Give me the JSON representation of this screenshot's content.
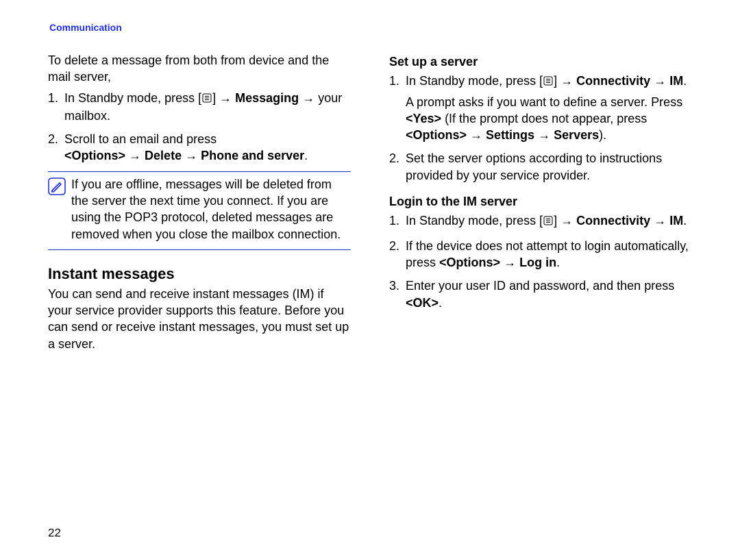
{
  "header": "Communication",
  "pagenum": "22",
  "arrows": {
    "right": "→"
  },
  "icons": {
    "menu_alt": "menu-icon",
    "note_alt": "note-icon"
  },
  "left": {
    "intro": "To delete a message from both from device and the mail server,",
    "step1_a": "In Standby mode, press [",
    "step1_b": "] ",
    "step1_c": "Messaging",
    "step1_d": " your mailbox.",
    "step2_a": "Scroll to an email and press ",
    "step2_b": "<Options>",
    "step2_c": "Delete",
    "step2_d": "Phone and server",
    "step2_e": ".",
    "note": "If you are offline, messages will be deleted from the server the next time you connect. If you are using the POP3 protocol, deleted messages are removed when you close the mailbox connection.",
    "im_heading": "Instant messages",
    "im_body": "You can send and receive instant messages (IM) if your service provider supports this feature. Before you can send or receive instant messages, you must set up a server."
  },
  "right": {
    "setup_heading": "Set up a server",
    "s1_a": "In Standby mode, press [",
    "s1_b": "] ",
    "s1_c": "Connectivity",
    "s1_d": "IM",
    "s1_e": ".",
    "s1_f_a": "A prompt asks if you want to define a server. Press ",
    "s1_f_b": "<Yes>",
    "s1_f_c": " (If the prompt does not appear, press ",
    "s1_f_d": "<Options>",
    "s1_f_e": "Settings",
    "s1_f_f": "Servers",
    "s1_f_g": ").",
    "s2": "Set the server options according to instructions provided by your service provider.",
    "login_heading": "Login to the IM server",
    "l1_a": "In Standby mode, press [",
    "l1_b": "] ",
    "l1_c": "Connectivity",
    "l1_d": "IM",
    "l1_e": ".",
    "l2_a": "If the device does not attempt to login automatically, press ",
    "l2_b": "<Options>",
    "l2_c": "Log in",
    "l2_d": ".",
    "l3_a": "Enter your user ID and password, and then press ",
    "l3_b": "<OK>",
    "l3_c": "."
  }
}
